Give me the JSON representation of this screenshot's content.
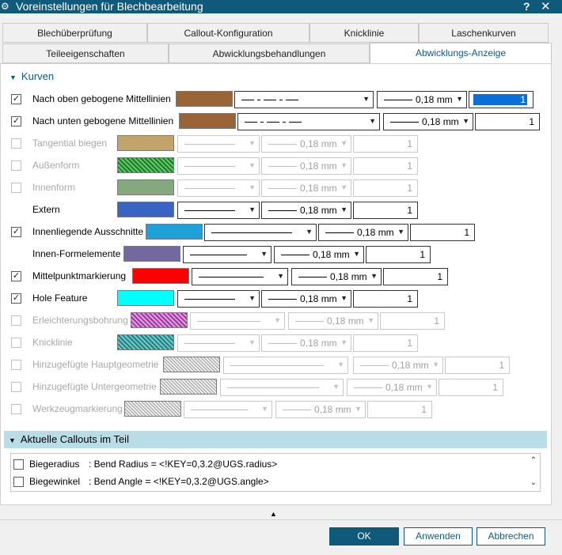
{
  "window": {
    "title": "Voreinstellungen für Blechbearbeitung",
    "help": "?",
    "close": "✕"
  },
  "tabs_row1": [
    {
      "label": "Blechüberprüfung"
    },
    {
      "label": "Callout-Konfiguration"
    },
    {
      "label": "Knicklinie"
    },
    {
      "label": "Laschenkurven"
    }
  ],
  "tabs_row2": [
    {
      "label": "Teileeigenschaften"
    },
    {
      "label": "Abwicklungsbehandlungen"
    },
    {
      "label": "Abwicklungs-Anzeige",
      "active": true
    }
  ],
  "section_curves": {
    "title": "Kurven"
  },
  "rows": [
    {
      "checked": true,
      "enabled": true,
      "label": "Nach oben gebogene Mittellinien",
      "color": "#9b6436",
      "line_style": "dash-dot",
      "width": "0,18 mm",
      "value": "1",
      "focused": true
    },
    {
      "checked": true,
      "enabled": true,
      "label": "Nach unten gebogene Mittellinien",
      "color": "#9b6436",
      "line_style": "dash-dot",
      "width": "0,18 mm",
      "value": "1"
    },
    {
      "checked": false,
      "enabled": false,
      "label": "Tangential biegen",
      "color": "#c0a46a",
      "line_style": "solid",
      "width": "0,18 mm",
      "value": "1"
    },
    {
      "checked": false,
      "enabled": false,
      "label": "Außenform",
      "color": "#2e9e3e",
      "pattern": "green",
      "line_style": "solid",
      "width": "0,18 mm",
      "value": "1"
    },
    {
      "checked": false,
      "enabled": false,
      "label": "Innenform",
      "color": "#86a87e",
      "line_style": "solid",
      "width": "0,18 mm",
      "value": "1"
    },
    {
      "checked": null,
      "enabled": true,
      "label": "Extern",
      "color": "#3a64c4",
      "line_style": "solid",
      "width": "0,18 mm",
      "value": "1"
    },
    {
      "checked": true,
      "enabled": true,
      "label": "Innenliegende Ausschnitte",
      "color": "#1fa0d6",
      "line_style": "solid",
      "width": "0,18 mm",
      "value": "1"
    },
    {
      "checked": null,
      "enabled": true,
      "label": "Innen-Formelemente",
      "color": "#7567a0",
      "line_style": "solid",
      "width": "0,18 mm",
      "value": "1"
    },
    {
      "checked": true,
      "enabled": true,
      "label": "Mittelpunktmarkierung",
      "color": "#ff0000",
      "line_style": "solid",
      "width": "0,18 mm",
      "value": "1"
    },
    {
      "checked": true,
      "enabled": true,
      "label": "Hole Feature",
      "color": "#00ffff",
      "line_style": "solid",
      "width": "0,18 mm",
      "value": "1"
    },
    {
      "checked": false,
      "enabled": false,
      "label": "Erleichterungsbohrung",
      "color": "#c45ec4",
      "pattern": "pink",
      "line_style": "solid",
      "width": "0,18 mm",
      "value": "1"
    },
    {
      "checked": false,
      "enabled": false,
      "label": "Knicklinie",
      "color": "#3aa5a5",
      "pattern": "teal",
      "line_style": "solid",
      "width": "0,18 mm",
      "value": "1"
    },
    {
      "checked": false,
      "enabled": false,
      "label": "Hinzugefügte Hauptgeometrie",
      "color": "#d8d8d8",
      "pattern": "gray",
      "line_style": "solid",
      "width": "0,18 mm",
      "value": "1"
    },
    {
      "checked": false,
      "enabled": false,
      "label": "Hinzugefügte Untergeometrie",
      "color": "#d8d8d8",
      "pattern": "gray",
      "line_style": "solid",
      "width": "0,18 mm",
      "value": "1"
    },
    {
      "checked": false,
      "enabled": false,
      "label": "Werkzeugmarkierung",
      "color": "#d8d8d8",
      "pattern": "gray",
      "line_style": "solid",
      "width": "0,18 mm",
      "value": "1"
    }
  ],
  "section_callouts": {
    "title": "Aktuelle Callouts im Teil"
  },
  "callouts": [
    {
      "name": "Biegeradius",
      "value": ": Bend Radius = <!KEY=0,3.2@UGS.radius>"
    },
    {
      "name": "Biegewinkel",
      "value": ": Bend Angle = <!KEY=0,3.2@UGS.angle>"
    }
  ],
  "buttons": {
    "ok": "OK",
    "apply": "Anwenden",
    "cancel": "Abbrechen"
  }
}
